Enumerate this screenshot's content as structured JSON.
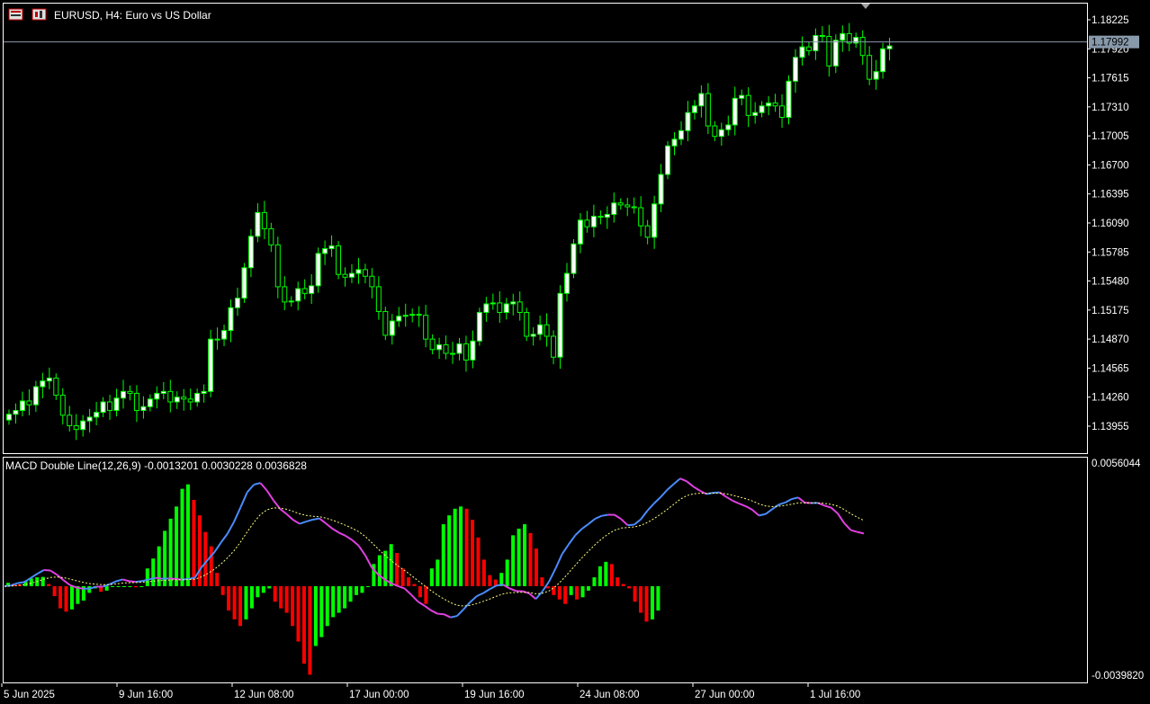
{
  "header": {
    "symbol_label": "EURUSD, H4:  Euro vs US Dollar"
  },
  "macd_header": {
    "label": "MACD Double Line(12,26,9) -0.0013201 0.0030228 0.0036828"
  },
  "current_price": "1.17992",
  "colors": {
    "background": "#000000",
    "frame": "#ffffff",
    "candle": "#00ff00",
    "bull_body": "#ffffff",
    "bear_body": "#000000",
    "hist_up": "#00ff00",
    "hist_down": "#ff0000",
    "macd_up": "#4a8cff",
    "macd_down": "#e040e0",
    "signal": "#ffff80",
    "bid_line": "#8899aa"
  },
  "icons": [
    "chart-window-icon",
    "chart-type-icon",
    "shift-triangle-icon"
  ],
  "chart_data": [
    {
      "type": "candlestick",
      "title": "EURUSD, H4:  Euro vs US Dollar",
      "ylim": [
        1.138,
        1.185
      ],
      "y_ticks": [
        "1.18225",
        "1.17920",
        "1.17615",
        "1.17310",
        "1.17005",
        "1.16700",
        "1.16395",
        "1.16090",
        "1.15785",
        "1.15480",
        "1.15175",
        "1.14870",
        "1.14565",
        "1.14260",
        "1.13955"
      ],
      "x_ticks": [
        "5 Jun 2025",
        "9 Jun 16:00",
        "12 Jun 08:00",
        "17 Jun 00:00",
        "19 Jun 16:00",
        "24 Jun 08:00",
        "27 Jun 00:00",
        "1 Jul 16:00"
      ],
      "last_price": 1.17992,
      "closes": [
        1.1408,
        1.1412,
        1.1422,
        1.1418,
        1.1437,
        1.1443,
        1.1446,
        1.1428,
        1.1407,
        1.1396,
        1.1392,
        1.1401,
        1.1405,
        1.141,
        1.1421,
        1.1412,
        1.1425,
        1.1432,
        1.143,
        1.1412,
        1.1416,
        1.1424,
        1.143,
        1.1432,
        1.1421,
        1.1426,
        1.1424,
        1.1421,
        1.143,
        1.1432,
        1.1487,
        1.1487,
        1.1496,
        1.152,
        1.153,
        1.1562,
        1.1595,
        1.162,
        1.1603,
        1.1586,
        1.1542,
        1.1526,
        1.1527,
        1.154,
        1.1535,
        1.1543,
        1.1577,
        1.1582,
        1.1585,
        1.1555,
        1.1552,
        1.1556,
        1.156,
        1.1553,
        1.1542,
        1.1516,
        1.1491,
        1.1506,
        1.1511,
        1.1512,
        1.1513,
        1.1512,
        1.1487,
        1.1476,
        1.1481,
        1.1472,
        1.1472,
        1.1482,
        1.1465,
        1.1485,
        1.1515,
        1.1524,
        1.1525,
        1.1515,
        1.1524,
        1.1526,
        1.1515,
        1.149,
        1.1492,
        1.1502,
        1.149,
        1.1468,
        1.1535,
        1.1556,
        1.1587,
        1.1612,
        1.1605,
        1.1616,
        1.1615,
        1.1618,
        1.163,
        1.1628,
        1.1626,
        1.1625,
        1.1606,
        1.1594,
        1.1629,
        1.166,
        1.169,
        1.1697,
        1.1706,
        1.1725,
        1.1732,
        1.1745,
        1.1711,
        1.17,
        1.1707,
        1.1712,
        1.174,
        1.1743,
        1.1722,
        1.1725,
        1.1732,
        1.1735,
        1.1732,
        1.172,
        1.1758,
        1.1783,
        1.1794,
        1.179,
        1.1806,
        1.1805,
        1.1774,
        1.1801,
        1.1808,
        1.1798,
        1.1804,
        1.1785,
        1.176,
        1.1768,
        1.1792,
        1.1795
      ],
      "macd_hist": [
        0.00015,
        0.00012,
        8e-05,
        0.00022,
        0.00035,
        0.0004,
        0.00042,
        0.0001,
        -0.00045,
        -0.001,
        -0.00115,
        -0.00105,
        -0.0008,
        -0.00065,
        -0.0003,
        -0.0001,
        -0.00025,
        -0.0002,
        0,
        0,
        0,
        0,
        -5e-05,
        0,
        0.0008,
        0.00125,
        0.0018,
        0.0025,
        0.00305,
        0.0036,
        0.0044,
        0.0046,
        0.0039,
        0.0032,
        0.00245,
        0.0018,
        0.0006,
        -0.0004,
        -0.0011,
        -0.0015,
        -0.0018,
        -0.0015,
        -0.001,
        -0.0005,
        -0.0003,
        -0.0001,
        -0.0007,
        -0.001,
        -0.0012,
        -0.0018,
        -0.0025,
        -0.0035,
        -0.004,
        -0.0027,
        -0.0023,
        -0.0018,
        -0.0014,
        -0.0012,
        -0.001,
        -0.0007,
        -0.0004,
        -0.0003,
        0,
        0.001,
        0.0014,
        0.0016,
        0.0019,
        0.0015,
        0.0008,
        0.0004,
        0.0001,
        -0.0005,
        -0.0008,
        0.0008,
        0.0012,
        0.0028,
        0.0032,
        0.0035,
        0.0036,
        0.0035,
        0.003,
        0.0022,
        0.0012,
        0.0005,
        0.0003,
        0.0006,
        0.0012,
        0.0023,
        0.0026,
        0.0028,
        0.0024,
        0.0017,
        0.0004,
        -0.0001,
        -0.0004,
        -0.0006,
        -0.0008,
        -0.0004,
        -0.0006,
        -0.0005,
        -0.0002,
        0.0004,
        0.0009,
        0.0011,
        0.001,
        0.0004,
        0.0001,
        -0.0001,
        -0.0007,
        -0.0012,
        -0.0016,
        -0.0015,
        -0.0011
      ],
      "macd_ylim": [
        -0.003982,
        0.0056044
      ],
      "macd_y_ticks": [
        "0.0056044",
        "-0.0039820"
      ]
    }
  ]
}
